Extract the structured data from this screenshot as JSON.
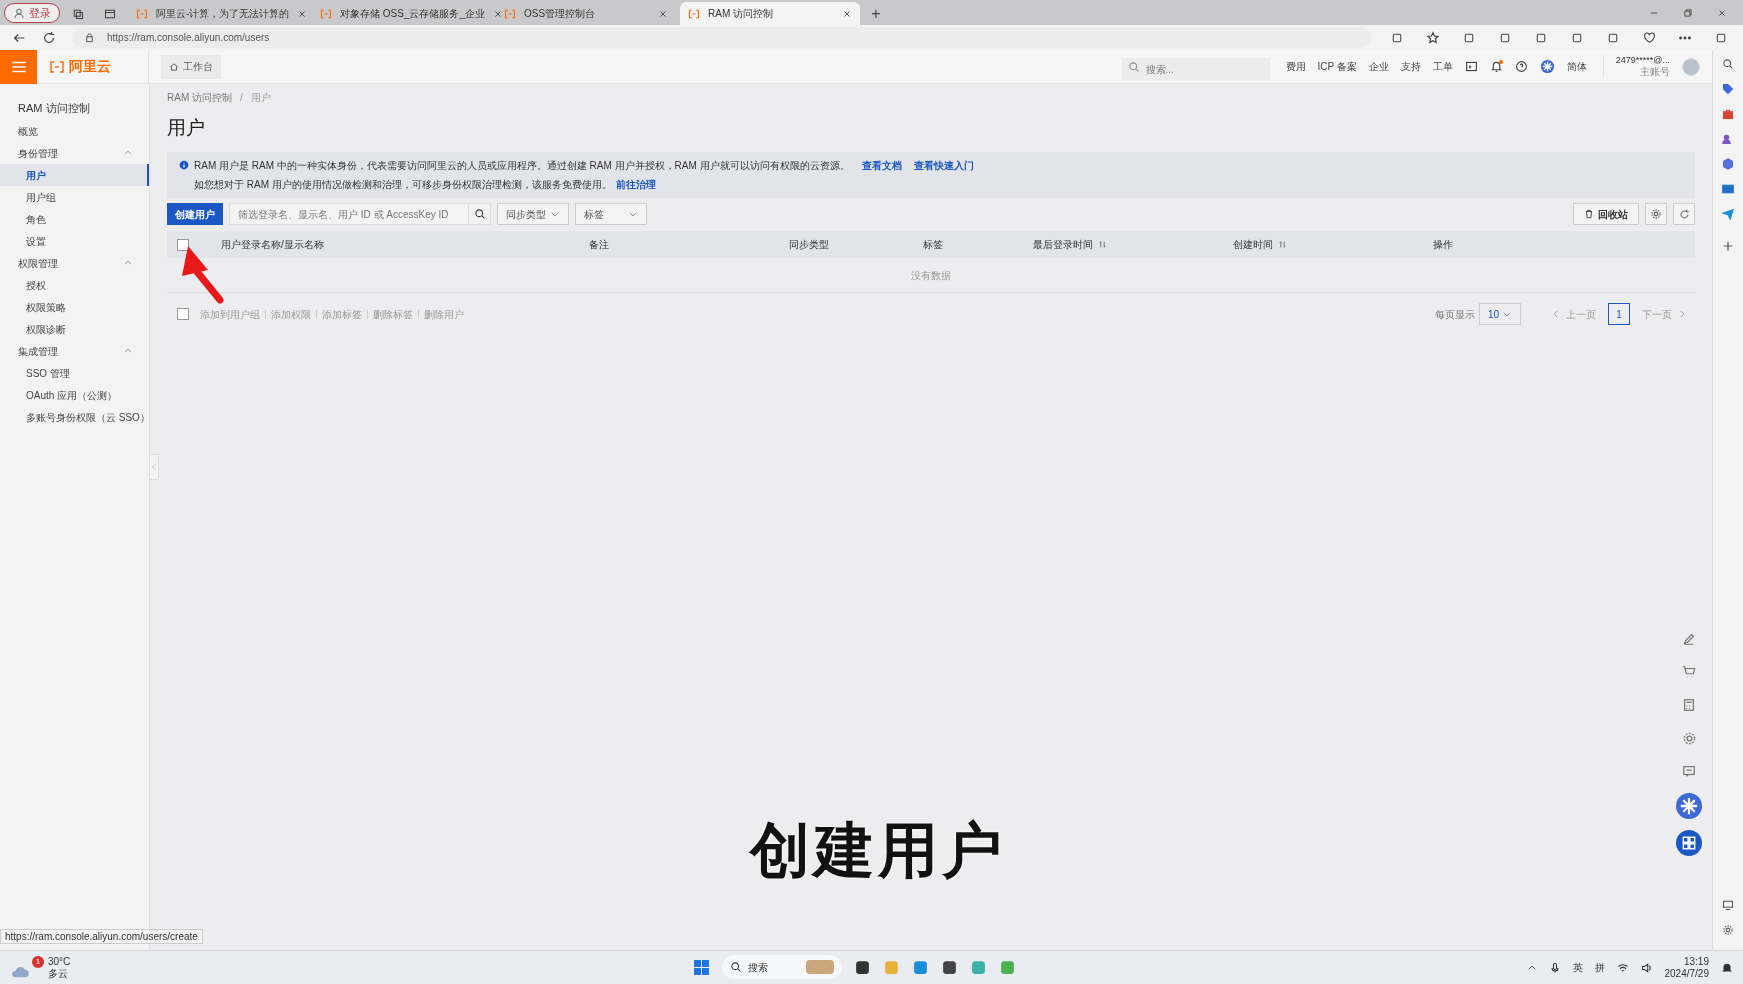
{
  "browser": {
    "profile_label": "登录",
    "tabs": [
      {
        "title": "阿里云-计算，为了无法计算的",
        "selected": false
      },
      {
        "title": "对象存储 OSS_云存储服务_企业",
        "selected": false
      },
      {
        "title": "OSS管理控制台",
        "selected": false
      },
      {
        "title": "RAM 访问控制",
        "selected": true
      }
    ],
    "new_tab": "+",
    "url": "https://ram.console.aliyun.com/users",
    "status_url": "https://ram.console.aliyun.com/users/create"
  },
  "header": {
    "logo": "阿里云",
    "workbench": "工作台",
    "search_placeholder": "搜索...",
    "nav": [
      "费用",
      "ICP 备案",
      "企业",
      "支持",
      "工单"
    ],
    "language": "简体",
    "account": "2479*****@...",
    "account_type": "主账号"
  },
  "sidebar": {
    "title": "RAM 访问控制",
    "items": [
      {
        "label": "概览",
        "selected": false
      },
      {
        "label": "身份管理",
        "expanded": true,
        "selected": false,
        "children": [
          {
            "label": "用户",
            "selected": true
          },
          {
            "label": "用户组",
            "selected": false
          },
          {
            "label": "角色",
            "selected": false
          },
          {
            "label": "设置",
            "selected": false
          }
        ]
      },
      {
        "label": "权限管理",
        "expanded": true,
        "selected": false,
        "children": [
          {
            "label": "授权",
            "selected": false
          },
          {
            "label": "权限策略",
            "selected": false
          },
          {
            "label": "权限诊断",
            "selected": false
          }
        ]
      },
      {
        "label": "集成管理",
        "expanded": true,
        "selected": false,
        "children": [
          {
            "label": "SSO 管理",
            "selected": false
          },
          {
            "label": "OAuth 应用（公测）",
            "selected": false
          },
          {
            "label": "多账号身份权限（云 SSO）",
            "selected": false
          }
        ]
      }
    ]
  },
  "breadcrumb": [
    "RAM 访问控制",
    "用户"
  ],
  "breadcrumb_separator": "/",
  "page_title": "用户",
  "notice": {
    "line1": "RAM 用户是 RAM 中的一种实体身份，代表需要访问阿里云的人员或应用程序。通过创建 RAM 用户并授权，RAM 用户就可以访问有权限的云资源。",
    "links1": [
      "查看文档",
      "查看快速入门"
    ],
    "line2": "如您想对于 RAM 用户的使用情况做检测和治理，可移步身份权限治理检测，该服务免费使用。",
    "link2": "前往治理"
  },
  "toolbar": {
    "create_button": "创建用户",
    "search_placeholder": "筛选登录名、显示名、用户 ID 或 AccessKey ID",
    "filters": [
      "同步类型",
      "标签"
    ],
    "recycle_button": "回收站"
  },
  "table": {
    "select_all_checked": false,
    "columns": [
      {
        "label": "用户登录名称/显示名称",
        "kind": "plain"
      },
      {
        "label": "备注",
        "kind": "plain"
      },
      {
        "label": "同步类型",
        "kind": "plain"
      },
      {
        "label": "标签",
        "kind": "plain"
      },
      {
        "label": "最后登录时间",
        "kind": "sortable"
      },
      {
        "label": "创建时间",
        "kind": "sortable"
      },
      {
        "label": "操作",
        "kind": "plain"
      }
    ],
    "empty_text": "没有数据"
  },
  "bulk": {
    "checked": false,
    "actions": [
      {
        "label": "添加到用户组",
        "disabled": true
      },
      {
        "label": "添加权限",
        "disabled": true
      },
      {
        "label": "添加标签",
        "disabled": true
      },
      {
        "label": "删除标签",
        "disabled": true
      },
      {
        "label": "删除用户",
        "disabled": true
      }
    ]
  },
  "pagination": {
    "page_size_label": "每页显示",
    "page_size": "10",
    "prev": "上一页",
    "pages": [
      {
        "label": "1",
        "selected": true
      }
    ],
    "next": "下一页"
  },
  "subtitle": "创建用户",
  "taskbar": {
    "temperature": "30°C",
    "weather": "多云",
    "weather_badge": "1",
    "search": "搜索",
    "ime": [
      "英",
      "拼"
    ],
    "time": "13:19",
    "date": "2024/7/29"
  }
}
